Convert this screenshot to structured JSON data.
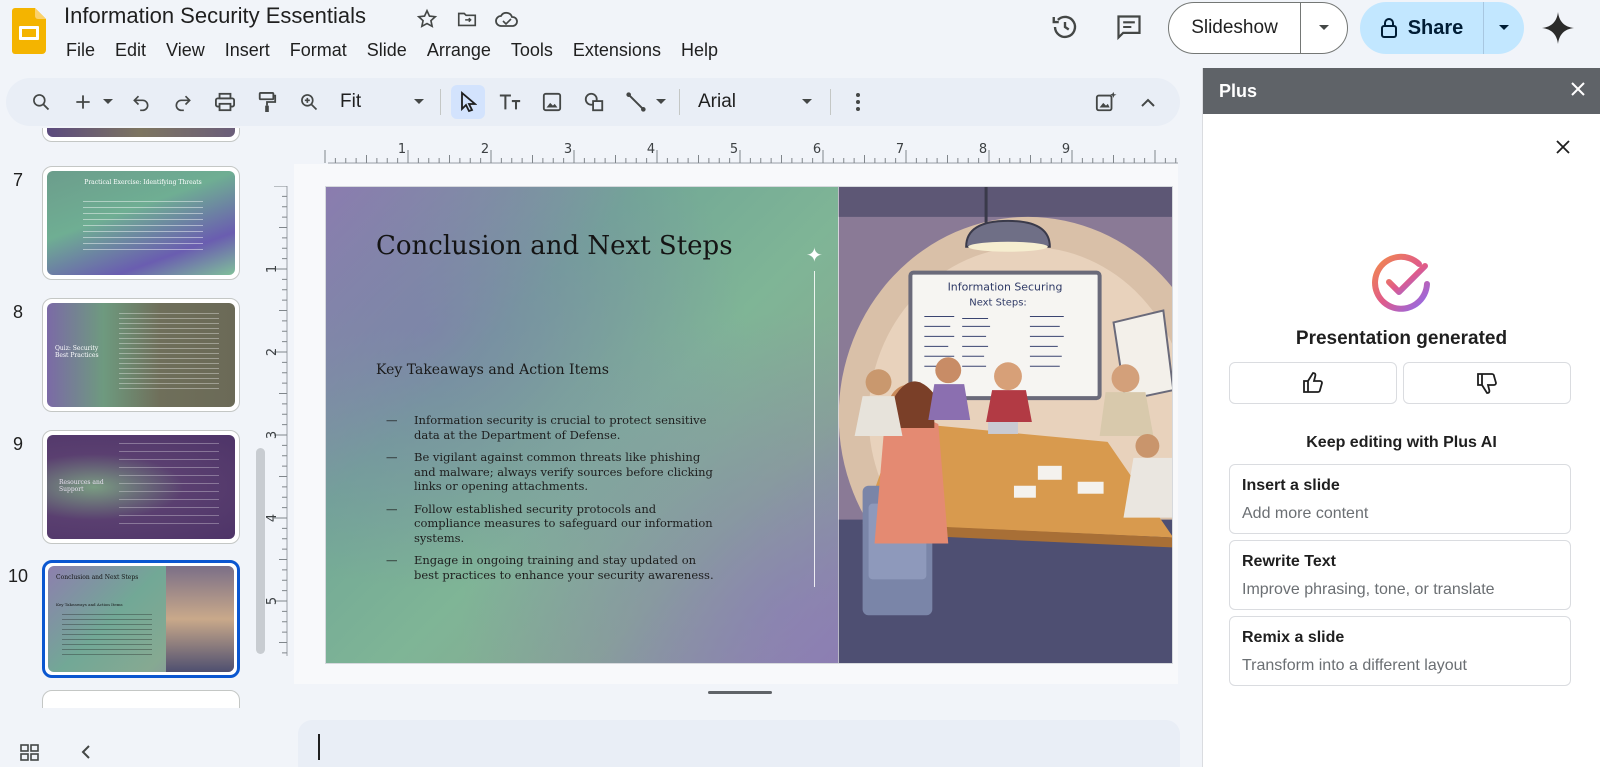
{
  "app": {
    "title": "Information Security Essentials"
  },
  "menu": [
    "File",
    "Edit",
    "View",
    "Insert",
    "Format",
    "Slide",
    "Arrange",
    "Tools",
    "Extensions",
    "Help"
  ],
  "header": {
    "slideshow_label": "Slideshow",
    "share_label": "Share"
  },
  "toolbar": {
    "zoom": "Fit",
    "font": "Arial"
  },
  "ruler": {
    "h": [
      "1",
      "2",
      "3",
      "4",
      "5",
      "6",
      "7",
      "8",
      "9"
    ],
    "v": [
      "1",
      "2",
      "3",
      "4",
      "5"
    ]
  },
  "filmstrip": [
    {
      "num": "7",
      "title": "Practical Exercise: Identifying Threats"
    },
    {
      "num": "8",
      "title": "Quiz: Security Best Practices"
    },
    {
      "num": "9",
      "title": "Resources and Support"
    },
    {
      "num": "10",
      "title": "Conclusion and Next Steps",
      "subtitle": "Key Takeaways and Action Items"
    }
  ],
  "slide": {
    "title": "Conclusion and Next Steps",
    "subtitle": "Key Takeaways and Action Items",
    "bullets": [
      "Information security is crucial to protect sensitive data at the Department of Defense.",
      "Be vigilant against common threats like phishing and malware; always verify sources before clicking links or opening attachments.",
      "Follow established security protocols and compliance measures to safeguard our information systems.",
      "Engage in ongoing training and stay updated on best practices to enhance your security awareness."
    ],
    "whiteboard_title": "Information Securing",
    "whiteboard_sub": "Next Steps:"
  },
  "panel": {
    "title": "Plus",
    "status": "Presentation generated",
    "keep_editing": "Keep editing with Plus AI",
    "cards": [
      {
        "title": "Insert a slide",
        "desc": "Add more content"
      },
      {
        "title": "Rewrite Text",
        "desc": "Improve phrasing, tone, or translate"
      },
      {
        "title": "Remix a slide",
        "desc": "Transform into a different layout"
      }
    ]
  },
  "colors": {
    "accent": "#0b57d0",
    "share_bg": "#c2e7ff",
    "logo": "#f4b400"
  }
}
